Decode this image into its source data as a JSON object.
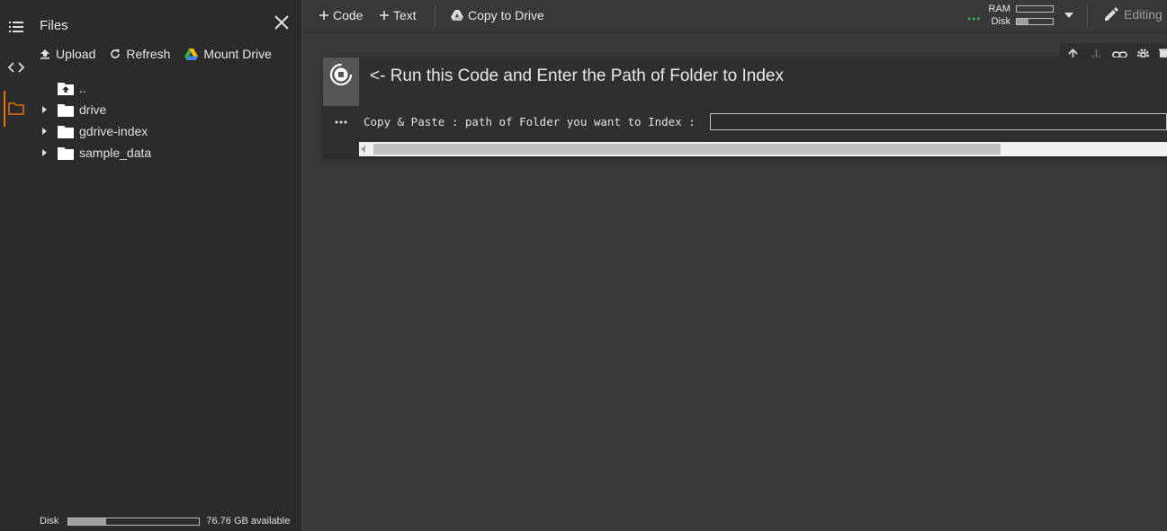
{
  "sidebar": {
    "title": "Files",
    "actions": {
      "upload": "Upload",
      "refresh": "Refresh",
      "mount_drive": "Mount Drive"
    },
    "tree": [
      {
        "label": "..",
        "icon": "folder-up-icon",
        "expandable": false
      },
      {
        "label": "drive",
        "icon": "folder-icon",
        "expandable": true
      },
      {
        "label": "gdrive-index",
        "icon": "folder-icon",
        "expandable": true
      },
      {
        "label": "sample_data",
        "icon": "folder-icon",
        "expandable": true
      }
    ],
    "disk": {
      "label": "Disk",
      "available": "76.76 GB available",
      "used_fraction": 0.29
    }
  },
  "toolbar": {
    "add_code": "Code",
    "add_text": "Text",
    "copy_to_drive": "Copy to Drive",
    "ram_label": "RAM",
    "disk_label": "Disk",
    "ram_fraction": 0.0,
    "disk_fraction": 0.33,
    "editing": "Editing"
  },
  "cell": {
    "title": "<- Run this Code and Enter the Path of Folder to Index",
    "form_label": "Copy & Paste : path of Folder you want to Index :",
    "input_value": "",
    "scroll_fraction": 0.78
  },
  "colors": {
    "accent": "#e8710a",
    "status_green": "#34a853",
    "background": "#383838",
    "panel": "#2b2b2b"
  }
}
